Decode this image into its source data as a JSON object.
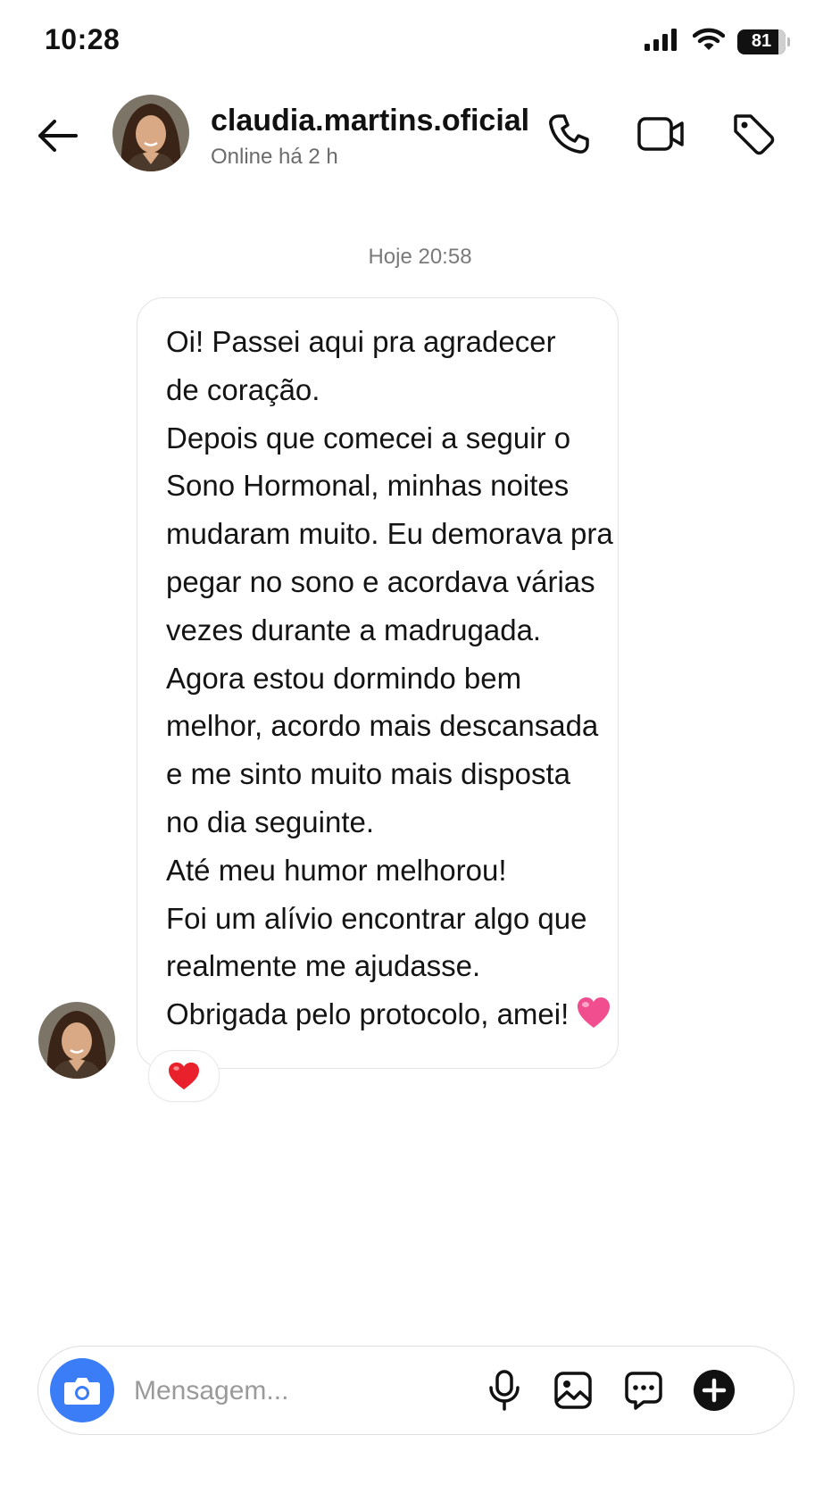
{
  "status_bar": {
    "time": "10:28",
    "battery": "81",
    "icons": [
      "cellular-signal-icon",
      "wifi-icon",
      "battery-icon"
    ]
  },
  "header": {
    "username": "claudia.martins.oficial",
    "status": "Online há 2 h",
    "icons": [
      "back-arrow-icon",
      "phone-icon",
      "video-camera-icon",
      "tag-icon"
    ]
  },
  "chat": {
    "timestamp": "Hoje 20:58",
    "message_lines": [
      "Oi! Passei aqui pra agradecer",
      "de coração.",
      "Depois que comecei a seguir o",
      "Sono Hormonal, minhas noites",
      "mudaram muito. Eu demorava pra",
      "pegar no sono e acordava várias",
      "vezes durante a madrugada.",
      "Agora estou dormindo bem",
      "melhor, acordo mais descansada",
      "e me sinto muito mais disposta",
      "no dia seguinte.",
      "Até meu humor melhorou!",
      "Foi um alívio encontrar algo que",
      "realmente me ajudasse.",
      "Obrigada pelo protocolo, amei!"
    ],
    "inline_emoji": "pink-heart-icon",
    "reaction": "red-heart-icon"
  },
  "composer": {
    "placeholder": "Mensagem...",
    "icons": [
      "camera-icon",
      "microphone-icon",
      "gallery-icon",
      "chat-bubble-icon",
      "plus-icon"
    ]
  },
  "colors": {
    "camera_button": "#3a7df6",
    "text": "#111111",
    "secondary_text": "#6b6b6b",
    "border": "#e3e3e3",
    "heart_red": "#e8212d",
    "heart_pink": "#f04e8e"
  }
}
